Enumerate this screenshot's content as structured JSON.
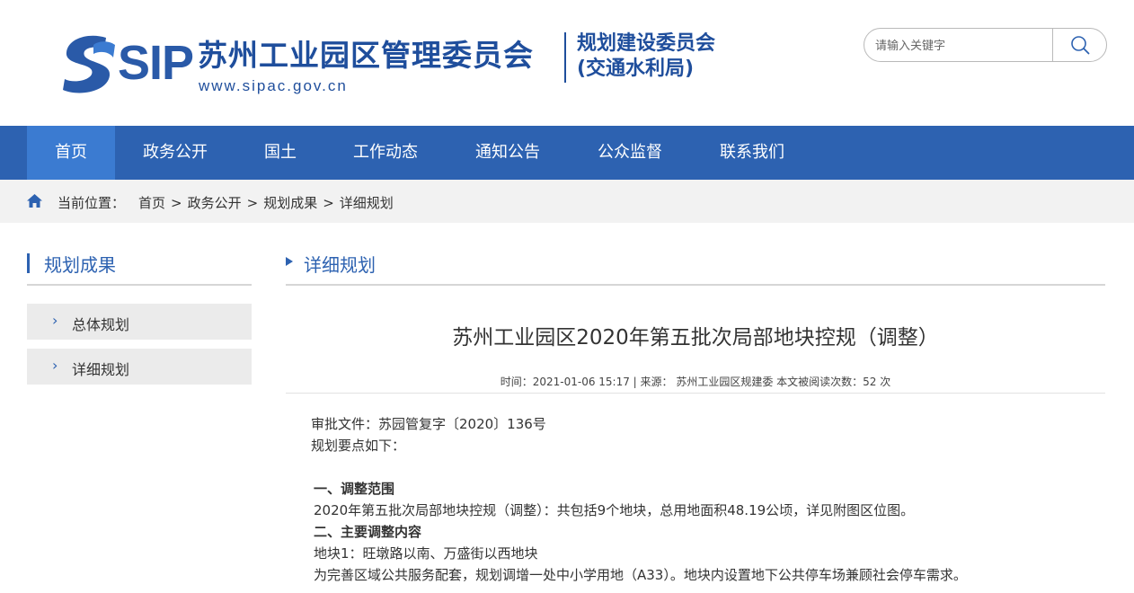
{
  "header": {
    "logo_text": "SIP",
    "org_name": "苏州工业园区管理委员会",
    "org_url": "www.sipac.gov.cn",
    "dept_line1": "规划建设委员会",
    "dept_line2": "(交通水利局)",
    "search": {
      "placeholder": "请输入关键字",
      "icon": "search-icon"
    }
  },
  "nav": {
    "items": [
      {
        "label": "首页",
        "active": true
      },
      {
        "label": "政务公开"
      },
      {
        "label": "国土"
      },
      {
        "label": "工作动态"
      },
      {
        "label": "通知公告"
      },
      {
        "label": "公众监督"
      },
      {
        "label": "联系我们"
      }
    ]
  },
  "breadcrumb": {
    "icon": "home-icon",
    "label": "当前位置：",
    "items": [
      "首页",
      "政务公开",
      "规划成果",
      "详细规划"
    ],
    "separator": ">"
  },
  "sidebar": {
    "title": "规划成果",
    "items": [
      {
        "label": "总体规划"
      },
      {
        "label": "详细规划"
      }
    ]
  },
  "main": {
    "section_title": "详细规划",
    "article": {
      "title": "苏州工业园区2020年第五批次局部地块控规（调整）",
      "meta": "时间：2021-01-06 15:17 | 来源： 苏州工业园区规建委    本文被阅读次数：52 次",
      "lines": [
        "审批文件：苏园管复字〔2020〕136号",
        "规划要点如下：",
        "",
        "一、调整范围",
        "2020年第五批次局部地块控规（调整）：共包括9个地块，总用地面积48.19公顷，详见附图区位图。",
        "二、主要调整内容",
        "地块1：旺墩路以南、万盛街以西地块",
        "为完善区域公共服务配套，规划调增一处中小学用地（A33）。地块内设置地下公共停车场兼顾社会停车需求。"
      ]
    }
  },
  "colors": {
    "brand_blue": "#2d62b1",
    "nav_active": "#3b7bd1",
    "logo_blue": "#1f4e9c"
  }
}
